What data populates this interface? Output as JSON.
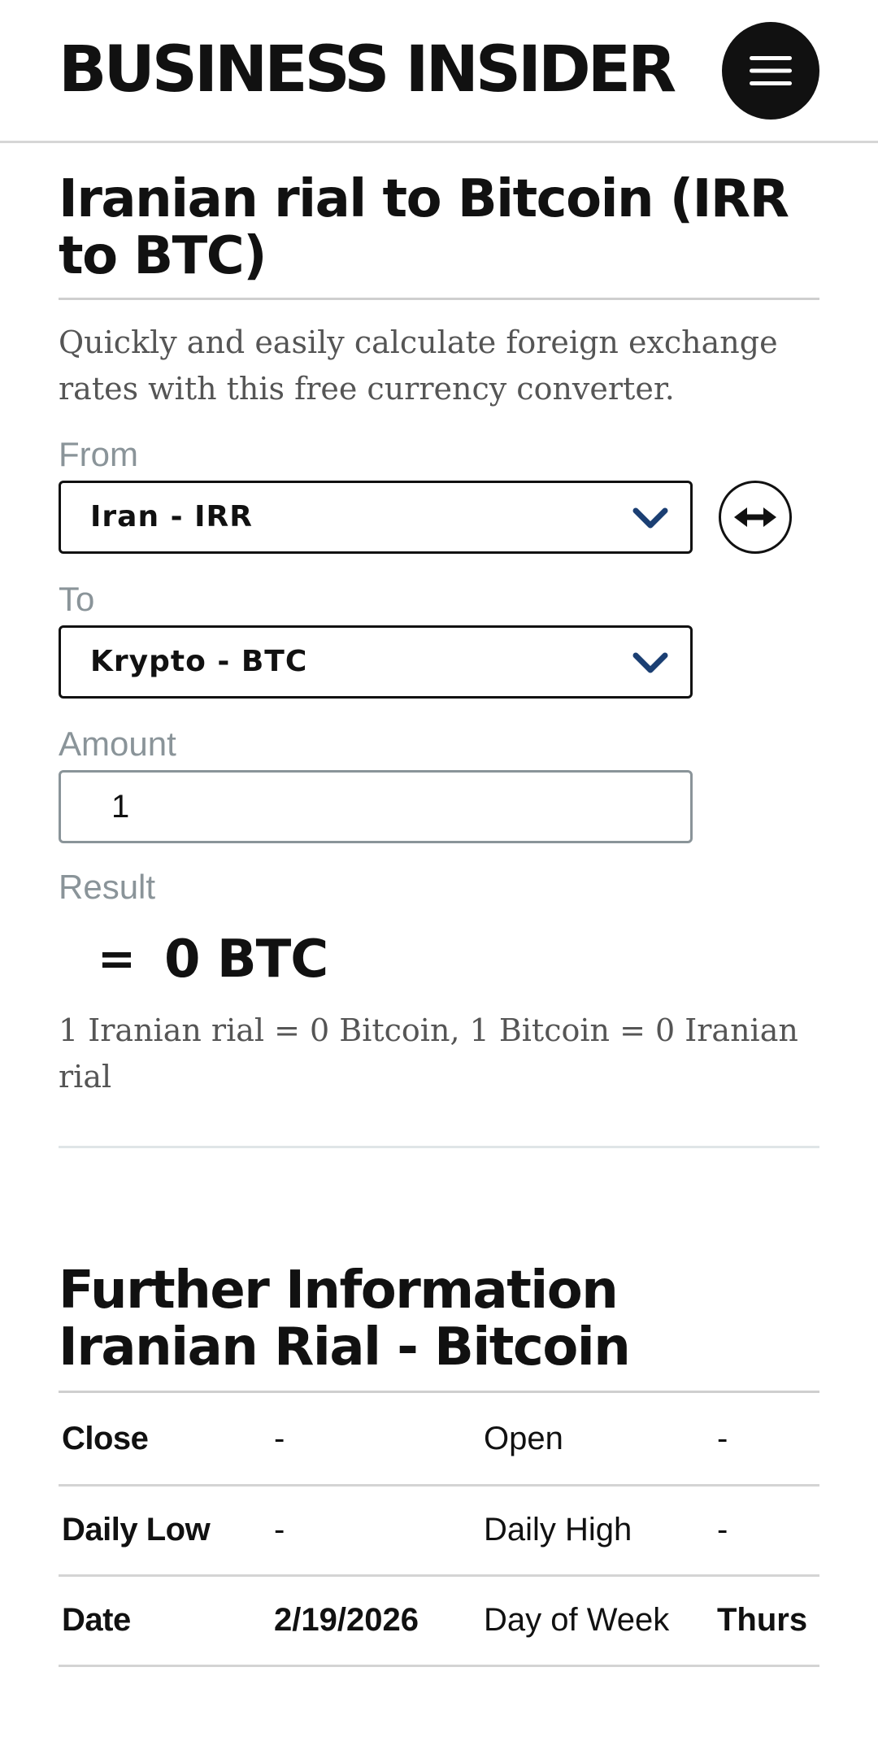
{
  "header": {
    "logo": "BUSINESS INSIDER",
    "menu_icon": "hamburger-menu-icon"
  },
  "converter": {
    "title": "Iranian rial to Bitcoin (IRR to BTC)",
    "intro": "Quickly and easily calculate foreign exchange rates with this free currency converter.",
    "from_label": "From",
    "from_value": "Iran - IRR",
    "to_label": "To",
    "to_value": "Krypto - BTC",
    "amount_label": "Amount",
    "amount_value": "1",
    "result_label": "Result",
    "result_eq": "=",
    "result_value": "0 BTC",
    "rate_text": "1 Iranian rial = 0 Bitcoin, 1 Bitcoin = 0 Iranian rial",
    "swap_icon": "swap-arrows-icon",
    "dropdown_icon": "chevron-down-icon",
    "accent_color": "#1b3f73"
  },
  "further": {
    "title": "Further Information Iranian Rial - Bitcoin",
    "rows": [
      {
        "label1": "Close",
        "value1": "-",
        "label2": "Open",
        "value2": "-"
      },
      {
        "label1": "Daily Low",
        "value1": "-",
        "label2": "Daily High",
        "value2": "-"
      },
      {
        "label1": "Date",
        "value1": "2/19/2026",
        "label2": "Day of Week",
        "value2": "Thurs"
      }
    ]
  }
}
